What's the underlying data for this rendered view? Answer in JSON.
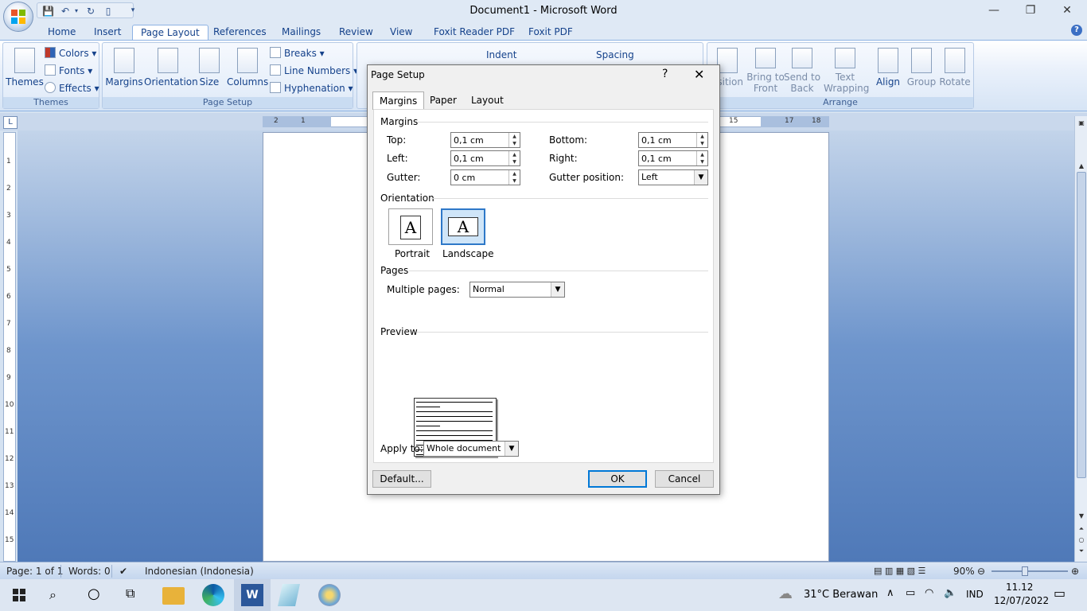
{
  "window": {
    "title": "Document1 - Microsoft Word",
    "minimize": "—",
    "restore": "❐",
    "close": "✕"
  },
  "ribbon_tabs": [
    "Home",
    "Insert",
    "Page Layout",
    "References",
    "Mailings",
    "Review",
    "View",
    "Foxit Reader PDF",
    "Foxit PDF"
  ],
  "active_tab": "Page Layout",
  "themes_group": {
    "themes": "Themes",
    "colors": "Colors",
    "fonts": "Fonts",
    "effects": "Effects",
    "label": "Themes"
  },
  "page_setup_group": {
    "margins": "Margins",
    "orientation": "Orientation",
    "size": "Size",
    "columns": "Columns",
    "breaks": "Breaks",
    "line_numbers": "Line Numbers",
    "hyphenation": "Hyphenation",
    "label": "Page Setup"
  },
  "paragraph_group": {
    "indent": "Indent",
    "spacing": "Spacing"
  },
  "arrange_group": {
    "position": "osition",
    "bring_to_front": [
      "Bring to",
      "Front"
    ],
    "send_to_back": [
      "Send to",
      "Back"
    ],
    "text_wrapping": [
      "Text",
      "Wrapping"
    ],
    "align": "Align",
    "group": "Group",
    "rotate": "Rotate",
    "label": "Arrange"
  },
  "ruler": {
    "left_numbers": [
      "2",
      "1"
    ],
    "right_numbers": [
      "15",
      "17",
      "18"
    ]
  },
  "vruler_numbers": [
    "1",
    "2",
    "3",
    "4",
    "5",
    "6",
    "7",
    "8",
    "9",
    "10",
    "11",
    "12",
    "13",
    "14",
    "15"
  ],
  "dialog": {
    "title": "Page Setup",
    "help": "?",
    "close": "✕",
    "tabs": [
      "Margins",
      "Paper",
      "Layout"
    ],
    "active_tab": "Margins",
    "margins_section": "Margins",
    "top_label": "Top:",
    "top_value": "0,1 cm",
    "bottom_label": "Bottom:",
    "bottom_value": "0,1 cm",
    "left_label": "Left:",
    "left_value": "0,1 cm",
    "right_label": "Right:",
    "right_value": "0,1 cm",
    "gutter_label": "Gutter:",
    "gutter_value": "0 cm",
    "gutter_position_label": "Gutter position:",
    "gutter_position_value": "Left",
    "orientation_section": "Orientation",
    "portrait": "Portrait",
    "landscape": "Landscape",
    "selected_orientation": "Landscape",
    "pages_section": "Pages",
    "multiple_pages_label": "Multiple pages:",
    "multiple_pages_value": "Normal",
    "preview_section": "Preview",
    "apply_to_label": "Apply to:",
    "apply_to_value": "Whole document",
    "default_button": "Default...",
    "ok_button": "OK",
    "cancel_button": "Cancel"
  },
  "statusbar": {
    "page": "Page: 1 of 1",
    "words": "Words: 0",
    "language": "Indonesian (Indonesia)",
    "zoom": "90%"
  },
  "taskbar": {
    "weather": "31°C Berawan",
    "language": "IND",
    "time": "11.12",
    "date": "12/07/2022"
  },
  "colors": {
    "ribbon_bg": "#dfe9f5",
    "workspace": "#6e95cc",
    "accent": "#0078d7",
    "tab_text": "#15428b"
  }
}
